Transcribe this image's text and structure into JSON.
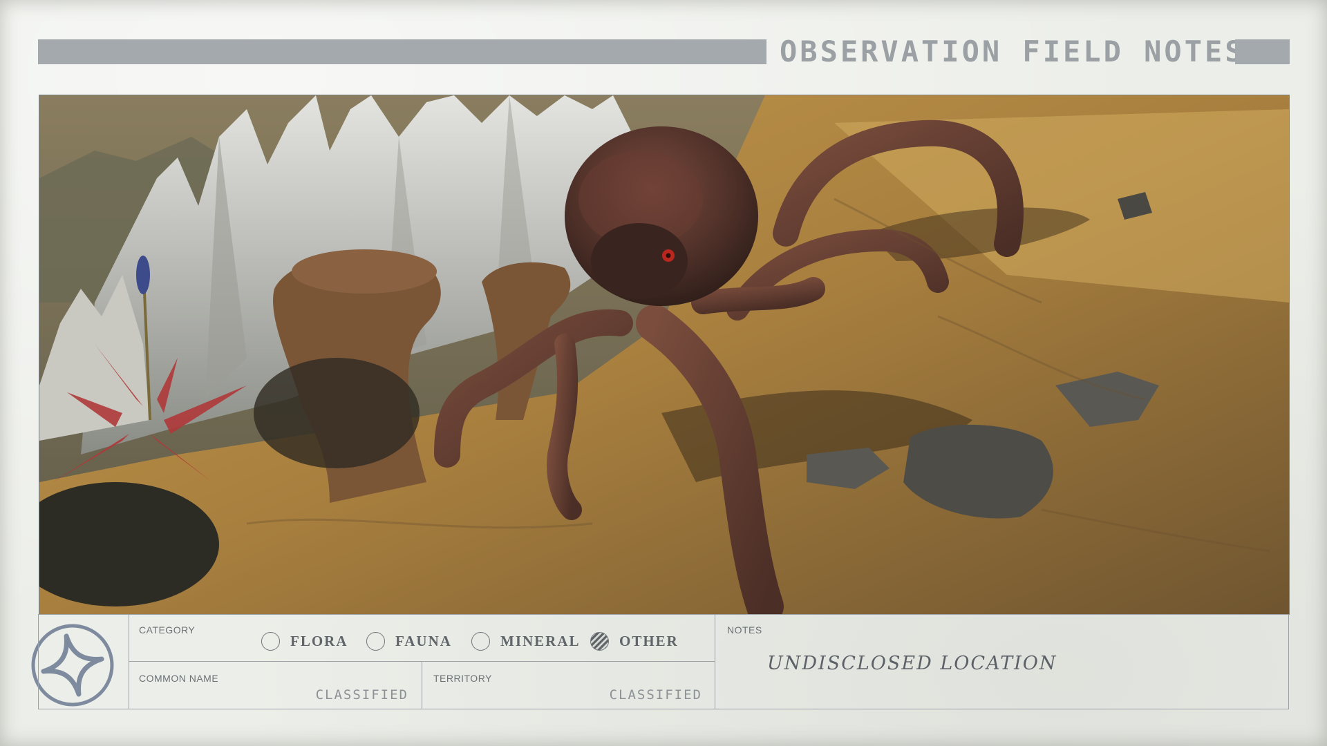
{
  "header": {
    "title": "OBSERVATION FIELD NOTES"
  },
  "photo": {
    "subject_icon": "creature-photo"
  },
  "form": {
    "emblem_icon": "constellation-star-icon",
    "category_label": "CATEGORY",
    "options": [
      {
        "label": "FLORA",
        "checked": false
      },
      {
        "label": "FAUNA",
        "checked": false
      },
      {
        "label": "MINERAL",
        "checked": false
      },
      {
        "label": "OTHER",
        "checked": true
      }
    ],
    "common_name_label": "COMMON NAME",
    "common_name_value": "CLASSIFIED",
    "territory_label": "TERRITORY",
    "territory_value": "CLASSIFIED",
    "notes_label": "NOTES",
    "notes_value": "UNDISCLOSED LOCATION"
  },
  "colors": {
    "paper": "#eceee9",
    "header_bar": "#a3a9ac",
    "ink": "#5f6569",
    "emblem": "#7e8a9e"
  }
}
